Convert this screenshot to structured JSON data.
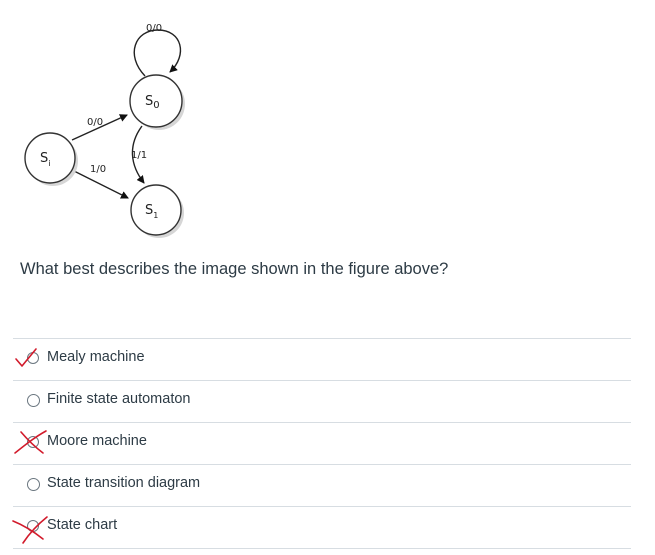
{
  "figure": {
    "states": {
      "initial": "S",
      "initial_sub": "i",
      "s0": "S",
      "s0_sub": "0",
      "s1": "S",
      "s1_sub": "1"
    },
    "transitions": {
      "s0_self_loop": "0/0",
      "si_to_s0": "0/0",
      "si_to_s1": "1/0",
      "s0_to_s1": "1/1"
    }
  },
  "question": {
    "text": "What best describes the image shown in the figure above?"
  },
  "answers": [
    {
      "label": "Mealy machine",
      "mark": "checkmark"
    },
    {
      "label": "Finite state automaton",
      "mark": "none"
    },
    {
      "label": "Moore machine",
      "mark": "cross"
    },
    {
      "label": "State transition diagram",
      "mark": "none"
    },
    {
      "label": "State chart",
      "mark": "cross"
    }
  ],
  "colors": {
    "mark_red": "#d21a2b",
    "text": "#2d3b45",
    "divider": "#d7dde2"
  }
}
